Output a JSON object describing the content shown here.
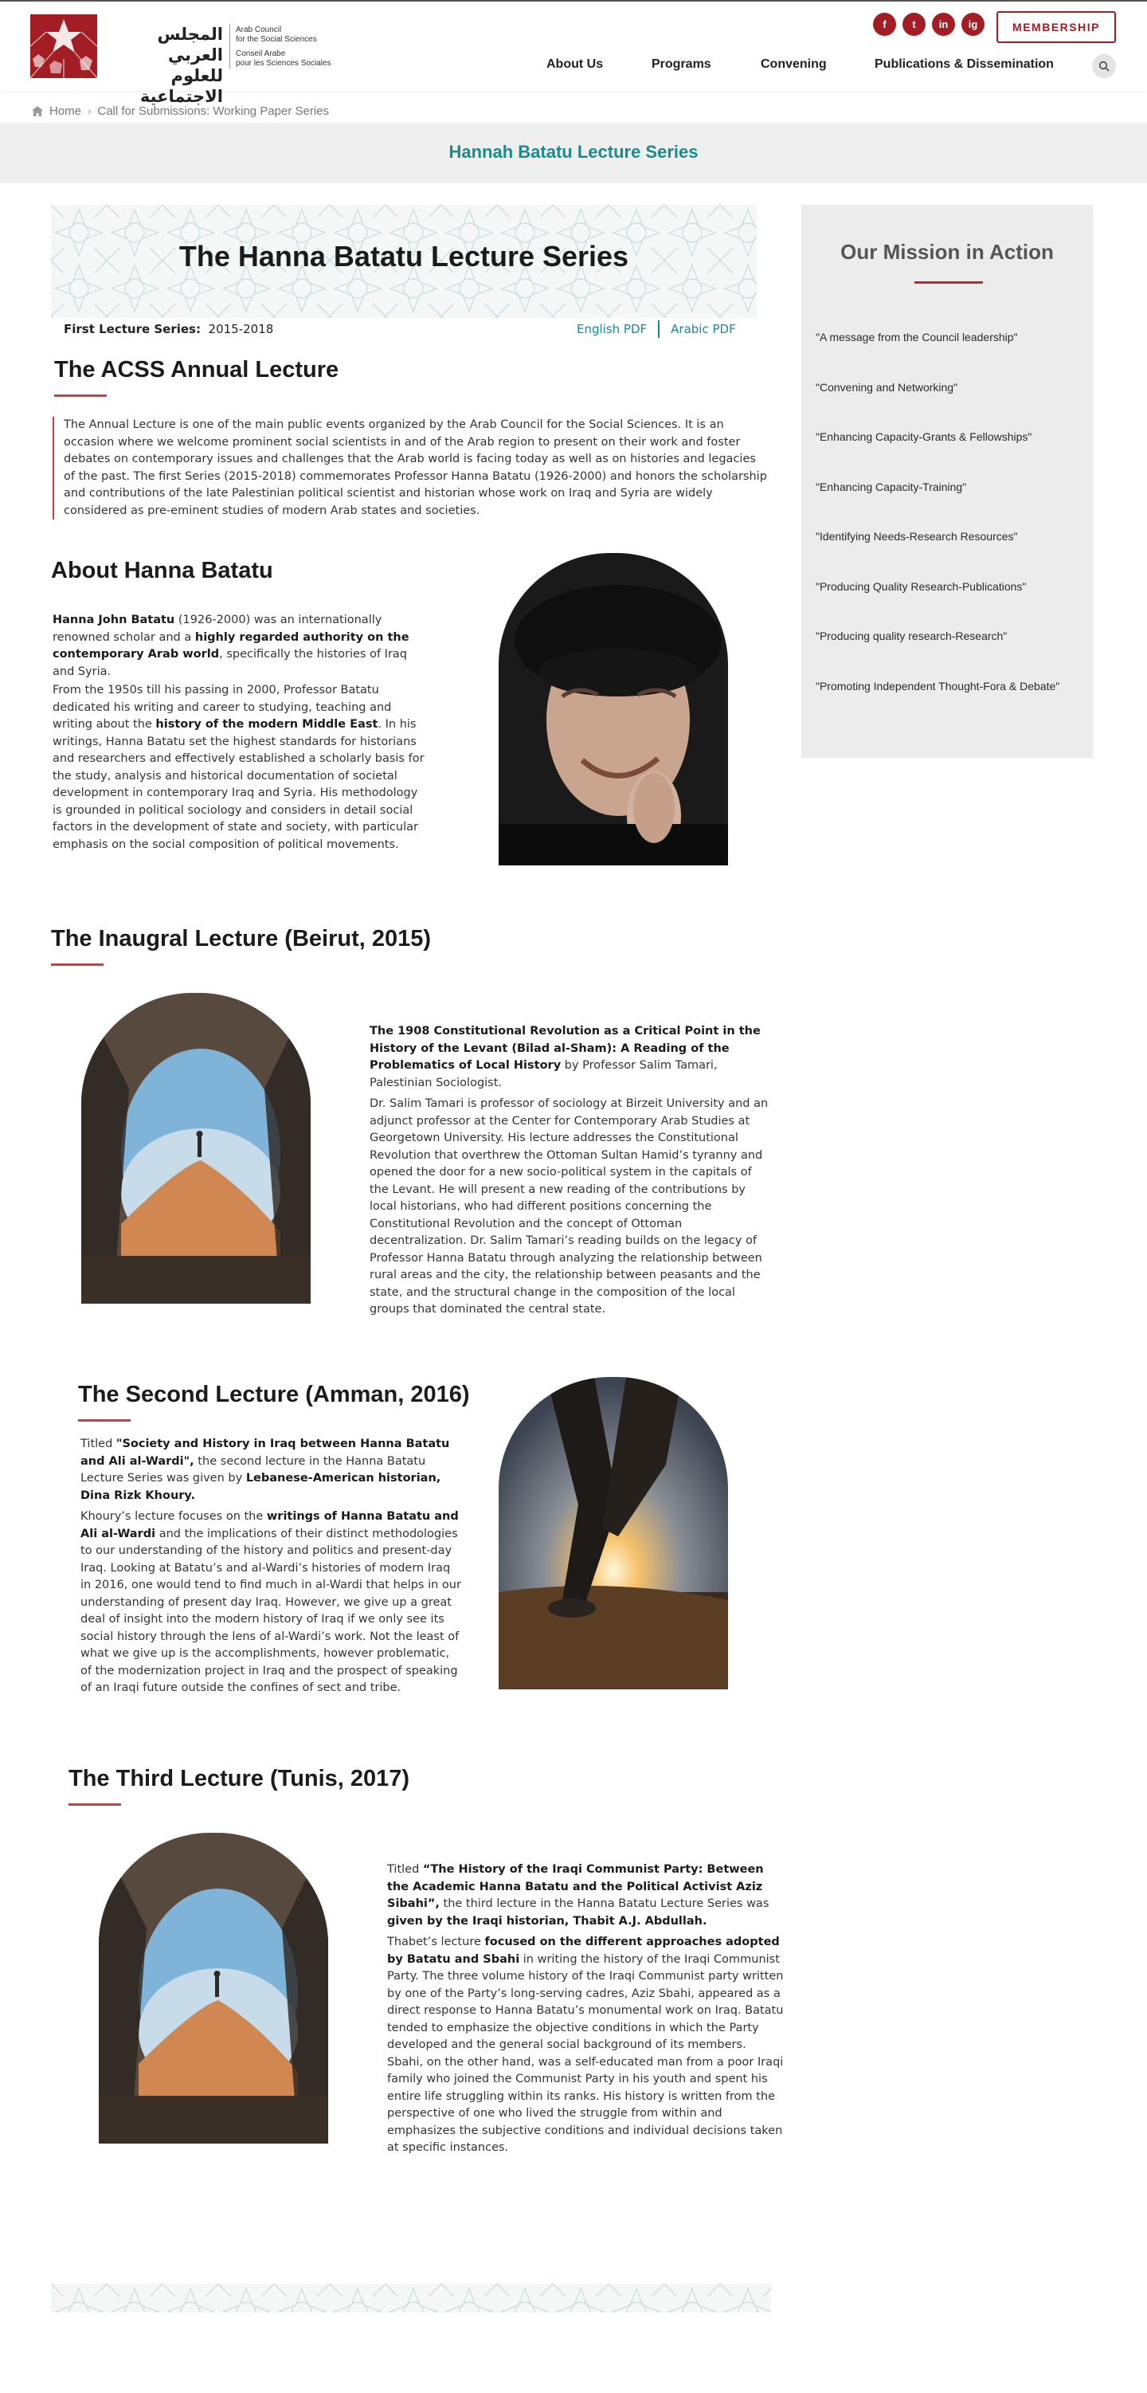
{
  "header": {
    "logo_ar_line1": "المجلس العربي",
    "logo_ar_line2": "للعلوم الاجتماعية",
    "logo_en_line1": "Arab Council",
    "logo_en_line2": "for the Social Sciences",
    "logo_fr_line1": "Conseil Arabe",
    "logo_fr_line2": "pour les Sciences Sociales",
    "socials": [
      {
        "label": "f",
        "icon": "facebook-icon"
      },
      {
        "label": "t",
        "icon": "twitter-icon"
      },
      {
        "label": "in",
        "icon": "linkedin-icon"
      },
      {
        "label": "ig",
        "icon": "instagram-icon"
      }
    ],
    "membership_label": "MEMBERSHIP",
    "nav": [
      "About Us",
      "Programs",
      "Convening",
      "Publications & Dissemination"
    ],
    "brand_color": "#a31d24"
  },
  "breadcrumb": {
    "home": "Home",
    "current": "Call for Submissions: Working Paper Series"
  },
  "band": {
    "title": "Hannah Batatu Lecture Series",
    "accent": "#1a8a8a"
  },
  "banner": {
    "title": "The Hanna Batatu Lecture Series"
  },
  "series": {
    "label": "First Lecture Series:",
    "value": "2015-2018",
    "english_pdf": "English PDF",
    "arabic_pdf": "Arabic PDF"
  },
  "annual": {
    "heading": "The ACSS Annual Lecture",
    "text": "The Annual Lecture is one of the main public events organized by the Arab Council for the Social Sciences. It is an occasion where we welcome prominent social scientists in and of the Arab region to present on their work and foster debates on contemporary issues and challenges that the Arab world is facing today as well as on histories and legacies of the past. The first Series (2015-2018) commemorates Professor Hanna Batatu (1926-2000) and honors the scholarship and contributions of the late Palestinian political scientist and historian whose work on Iraq and Syria are widely considered as pre-eminent studies of modern Arab states and societies."
  },
  "about": {
    "heading": "About Hanna Batatu",
    "p1_name": "Hanna John Batatu",
    "p1_a": " (1926-2000) was an internationally renowned scholar and a ",
    "p1_b": "highly regarded authority on the contemporary Arab world",
    "p1_c": ", specifically the histories of Iraq and Syria.",
    "p2_a": "From the 1950s till his passing in 2000, Professor Batatu dedicated his writing and career to studying, teaching and writing about the ",
    "p2_b": "history of the modern Middle East",
    "p2_c": ". In his writings, Hanna Batatu set the highest standards for historians and researchers and effectively established a scholarly basis for the study, analysis and historical documentation of societal development in contemporary Iraq and Syria. His methodology is grounded in political sociology and considers in detail social factors in the development of state and society, with particular emphasis on the social composition of political movements."
  },
  "inaugural": {
    "heading": "The Inaugral Lecture (Beirut, 2015)",
    "title_bold": "The 1908 Constitutional Revolution as a Critical Point in the History of the Levant (Bilad al-Sham): A Reading of the Problematics of Local History",
    "title_rest": " by Professor Salim Tamari, Palestinian Sociologist.",
    "body": "Dr. Salim Tamari is professor of sociology at Birzeit University and an adjunct professor at the Center for Contemporary Arab Studies at Georgetown University.  His lecture addresses the Constitutional Revolution that overthrew the Ottoman Sultan Hamid’s tyranny and opened the door for a new socio-political system in the capitals of the Levant. He will present a new reading of the contributions by local historians, who had different positions concerning the Constitutional Revolution and the concept of Ottoman decentralization. Dr. Salim Tamari’s reading builds on the legacy of Professor Hanna Batatu through analyzing the relationship between rural areas and the city, the relationship between peasants and the state, and the structural change in the composition of the local groups that dominated the central state."
  },
  "second": {
    "heading": "The Second Lecture (Amman, 2016)",
    "p1_a": "Titled ",
    "p1_b": "\"Society and History in Iraq between Hanna Batatu and Ali al-Wardi\",",
    "p1_c": " the second lecture in the Hanna Batatu Lecture Series was given by ",
    "p1_d": "Lebanese-American historian, Dina Rizk Khoury.",
    "p2_a": "Khoury’s lecture focuses on the ",
    "p2_b": "writings of Hanna Batatu and Ali al-Wardi",
    "p2_c": " and the implications of their distinct methodologies to our understanding of the history and politics and present-day Iraq. Looking at Batatu’s and al-Wardi’s histories of modern Iraq in 2016, one would tend to find much in al-Wardi that helps in our understanding of present day Iraq. However, we give up a great deal of insight into the modern history of Iraq if we only see its social history through the lens of al-Wardi’s work. Not the least of what we give up is the accomplishments, however problematic, of the modernization project in Iraq and the prospect of speaking of an Iraqi future outside the confines of sect and tribe."
  },
  "third": {
    "heading": "The Third Lecture (Tunis, 2017)",
    "p1_a": "Titled ",
    "p1_b": "“The History of the Iraqi Communist Party: Between the Academic Hanna Batatu and the Political Activist Aziz Sibahi”,",
    "p1_c": " the third lecture in the Hanna Batatu Lecture Series was ",
    "p1_d": "given by the Iraqi historian, Thabit A.J. Abdullah.",
    "p2_a": "Thabet’s lecture ",
    "p2_b": "focused on the different approaches adopted by Batatu and Sbahi",
    "p2_c": " in writing the history of the Iraqi Communist Party. The three volume history of the Iraqi Communist party written by one of the Party’s long-serving cadres, Aziz Sbahi, appeared as a direct response to Hanna Batatu’s monumental work on Iraq. Batatu tended to emphasize the objective conditions in which the Party developed and the general social background of its members. Sbahi, on the other hand, was a self-educated man from a poor Iraqi family who joined the Communist Party in his youth and spent his entire life struggling within its ranks. His history is written from the perspective of one who lived the struggle from within and emphasizes the subjective conditions and individual decisions taken at specific instances."
  },
  "sidebar": {
    "title": "Our Mission in Action",
    "items": [
      "\"A message from the Council leadership\"",
      "\"Convening and Networking\"",
      "\"Enhancing Capacity-Grants & Fellowships\"",
      "\"Enhancing Capacity-Training\"",
      "\"Identifying Needs-Research Resources\"",
      "\"Producing Quality Research-Publications\"",
      "\"Producing quality research-Research\"",
      "\"Promoting Independent Thought-Fora & Debate\""
    ]
  }
}
